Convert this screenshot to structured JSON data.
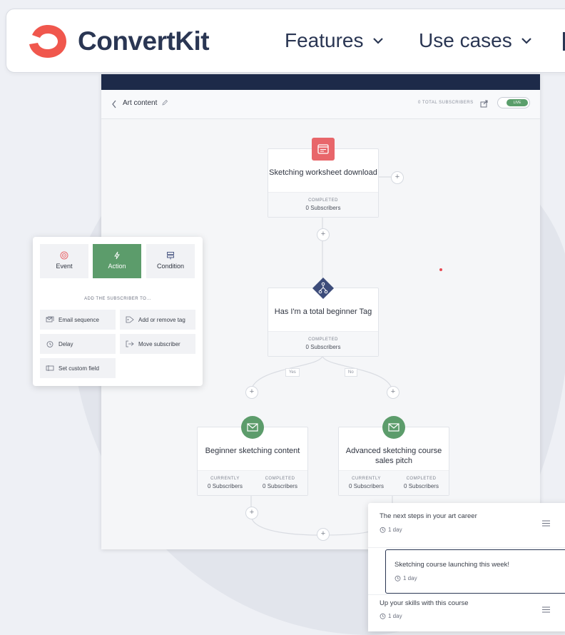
{
  "brand": {
    "name": "ConvertKit",
    "accent": "#f0574d",
    "navy": "#2a3653",
    "green": "#5c9c6b"
  },
  "nav": [
    {
      "label": "Features"
    },
    {
      "label": "Use cases"
    }
  ],
  "app": {
    "breadcrumb": "Art content",
    "total_subscribers": "0 TOTAL SUBSCRIBERS",
    "live_label": "LIVE"
  },
  "nodes": {
    "trigger": {
      "title": "Sketching worksheet download",
      "stat_label": "COMPLETED",
      "stat_value": "0 Subscribers",
      "icon": "form-icon"
    },
    "condition": {
      "title": "Has I'm a total beginner Tag",
      "stat_label": "COMPLETED",
      "stat_value": "0 Subscribers",
      "icon": "branch-icon"
    },
    "left": {
      "title": "Beginner sketching content",
      "current_label": "CURRENTLY",
      "current_value": "0 Subscribers",
      "completed_label": "COMPLETED",
      "completed_value": "0 Subscribers",
      "icon": "email-icon"
    },
    "right": {
      "title": "Advanced sketching course sales pitch",
      "current_label": "CURRENTLY",
      "current_value": "0 Subscribers",
      "completed_label": "COMPLETED",
      "completed_value": "0 Subscribers",
      "icon": "email-icon"
    }
  },
  "branches": {
    "yes": "Yes",
    "no": "No"
  },
  "panel": {
    "tabs": [
      {
        "label": "Event",
        "icon": "target-icon"
      },
      {
        "label": "Action",
        "icon": "bolt-icon",
        "active": true
      },
      {
        "label": "Condition",
        "icon": "signpost-icon"
      }
    ],
    "heading": "ADD THE SUBSCRIBER TO...",
    "options": [
      {
        "label": "Email sequence",
        "icon": "sequence-icon"
      },
      {
        "label": "Add or remove tag",
        "icon": "tag-icon"
      },
      {
        "label": "Delay",
        "icon": "clock-icon"
      },
      {
        "label": "Move subscriber",
        "icon": "move-icon"
      },
      {
        "label": "Set custom field",
        "icon": "field-icon"
      }
    ]
  },
  "emails": [
    {
      "title": "The next steps in your art career",
      "delay": "1 day"
    },
    {
      "title": "Sketching course launching this week!",
      "delay": "1 day",
      "selected": true
    },
    {
      "title": "Up your skills with this course",
      "delay": "1 day"
    }
  ]
}
